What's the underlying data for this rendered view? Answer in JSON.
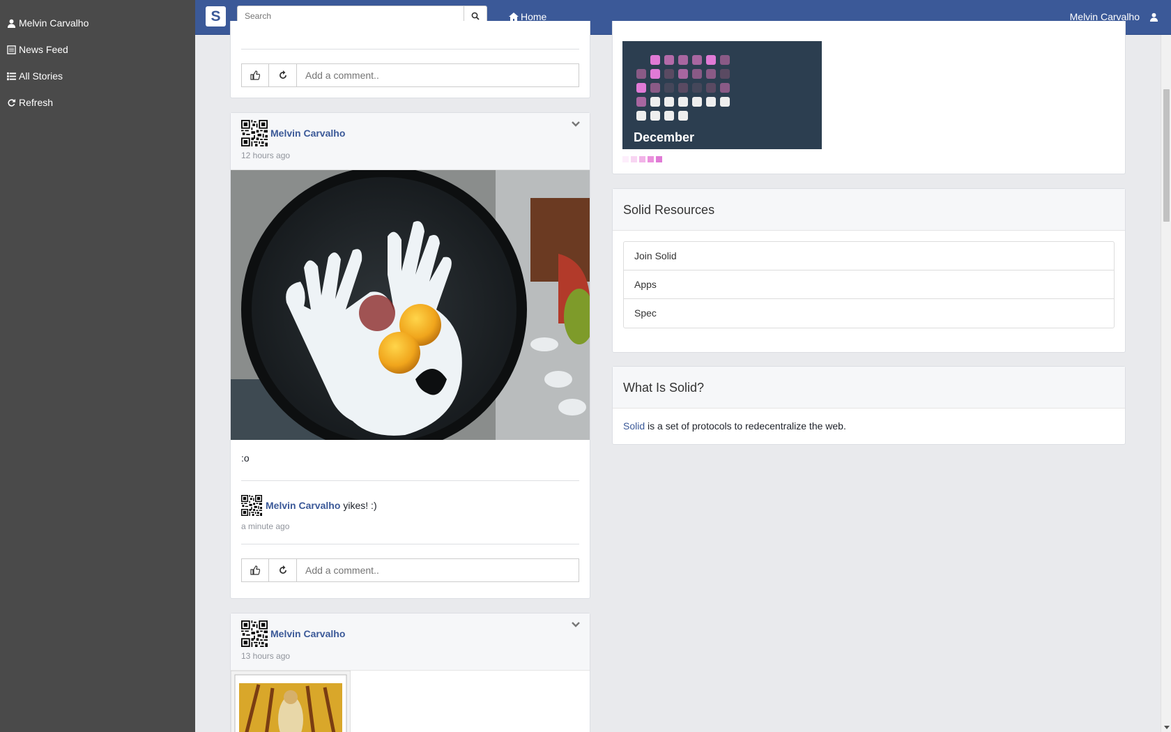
{
  "sidebar": {
    "items": [
      {
        "label": "Melvin Carvalho",
        "icon": "user-icon"
      },
      {
        "label": "News Feed",
        "icon": "newspaper-icon"
      },
      {
        "label": "All Stories",
        "icon": "list-icon"
      },
      {
        "label": "Refresh",
        "icon": "refresh-icon"
      }
    ]
  },
  "navbar": {
    "brand": "S",
    "search_placeholder": "Search",
    "home_label": "Home",
    "user_name": "Melvin Carvalho"
  },
  "posts": [
    {
      "comment_placeholder": "Add a comment.."
    },
    {
      "author": "Melvin Carvalho",
      "time": "12 hours ago",
      "image": "fried-egg-ghost-face-in-pan",
      "caption": ":o",
      "comment": {
        "author": "Melvin Carvalho",
        "text": "yikes! :)",
        "time": "a minute ago"
      },
      "comment_placeholder": "Add a comment.."
    },
    {
      "author": "Melvin Carvalho",
      "time": "13 hours ago",
      "image": "tarot-card-illustration"
    }
  ],
  "calendar": {
    "month": "December"
  },
  "resources": {
    "title": "Solid Resources",
    "items": [
      "Join Solid",
      "Apps",
      "Spec"
    ]
  },
  "about": {
    "title": "What Is Solid?",
    "link": "Solid",
    "text": " is a set of protocols to redecentralize the web."
  },
  "colors": {
    "sidebar_bg": "#4a4a4a",
    "navbar_bg": "#3b5998",
    "link": "#3b5998",
    "calendar_bg": "#2c3e50",
    "calendar_pink": "#e07ad6"
  }
}
